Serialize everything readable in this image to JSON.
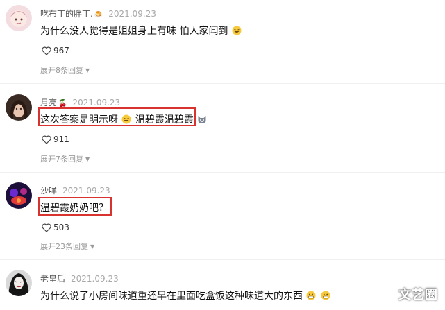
{
  "comments": [
    {
      "username": "吃布丁的胖丁.",
      "username_emoji": "🍮",
      "date": "2021.09.23",
      "text": "为什么没人觉得是姐姐身上有味 怕人家闻到",
      "likes": "967",
      "expand": "展开8条回复"
    },
    {
      "username": "月亮",
      "username_emoji": "🍒",
      "date": "2021.09.23",
      "text_a": "这次答案是明示呀",
      "text_b": "温碧霞温碧霞",
      "likes": "911",
      "expand": "展开7条回复"
    },
    {
      "username": "沙咩",
      "date": "2021.09.23",
      "text": "温碧霞奶奶吧？",
      "likes": "503",
      "expand": "展开23条回复"
    },
    {
      "username": "老皇后",
      "date": "2021.09.23",
      "text": "为什么说了小房间味道重还早在里面吃盒饭这种味道大的东西"
    }
  ],
  "watermark": "文艺圈",
  "colors": {
    "highlight": "#d8332f",
    "date": "#a8a8a8",
    "divider": "#efefef"
  },
  "icons": {
    "like": "heart-outline-icon",
    "expand": "caret-down-icon"
  }
}
